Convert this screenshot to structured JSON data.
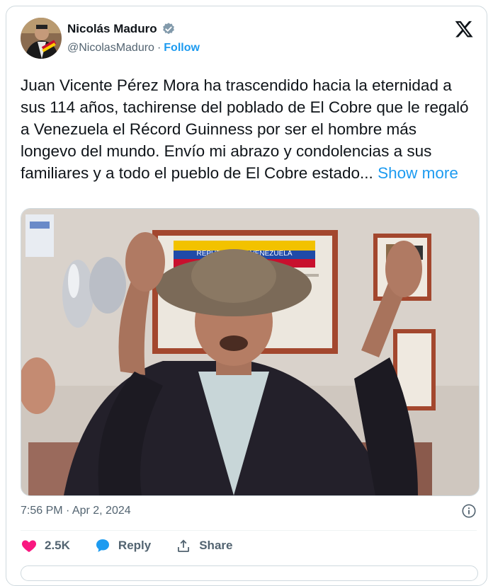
{
  "author": {
    "name": "Nicolás Maduro",
    "handle": "@NicolasMaduro",
    "separator": "·",
    "follow_label": "Follow"
  },
  "tweet": {
    "text": "Juan Vicente Pérez Mora ha trascendido hacia la eternidad a sus 114 años, tachirense del poblado de El Cobre que le regaló a Venezuela el Récord Guinness por ser el hombre más longevo del mundo. Envío mi abrazo y condolencias a sus familiares y a todo el pueblo de El Cobre estado...",
    "show_more_label": "Show more",
    "timestamp": "7:56 PM · Apr 2, 2024"
  },
  "media": {
    "certificate_text": "REPUBLICA DE VENEZUELA"
  },
  "actions": {
    "likes": "2.5K",
    "reply_label": "Reply",
    "share_label": "Share"
  },
  "colors": {
    "accent": "#1d9bf0",
    "like": "#f91880",
    "muted": "#536471"
  }
}
